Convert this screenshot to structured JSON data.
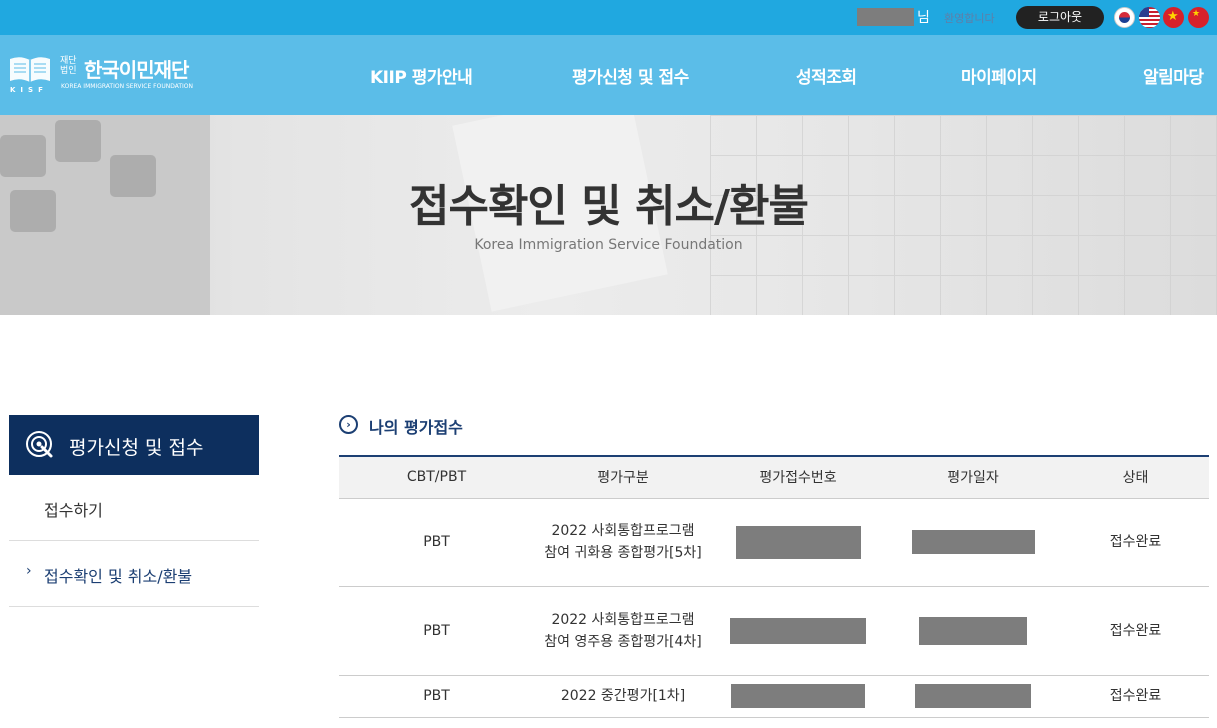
{
  "topbar": {
    "user_suffix": "님",
    "welcome": "환영합니다",
    "logout": "로그아웃",
    "flags": [
      "korea-flag",
      "usa-flag",
      "vietnam-flag",
      "china-flag"
    ]
  },
  "logo": {
    "legal_line1": "재단",
    "legal_line2": "법인",
    "name_ko": "한국이민재단",
    "name_en": "KOREA IMMIGRATION SERVICE FOUNDATION",
    "mark": "KISF"
  },
  "nav": [
    "KIIP 평가안내",
    "평가신청 및 접수",
    "성적조회",
    "마이페이지",
    "알림마당"
  ],
  "hero": {
    "title": "접수확인 및 취소/환불",
    "subtitle": "Korea Immigration Service Foundation"
  },
  "sidebar": {
    "heading": "평가신청 및 접수",
    "items": [
      {
        "label": "접수하기",
        "active": false
      },
      {
        "label": "접수확인 및 취소/환불",
        "active": true
      }
    ]
  },
  "section": {
    "title": "나의 평가접수"
  },
  "table": {
    "headers": [
      "CBT/PBT",
      "평가구분",
      "평가접수번호",
      "평가일자",
      "상태"
    ],
    "rows": [
      {
        "mode": "PBT",
        "type": "2022 사회통합프로그램 참여 귀화용 종합평가[5차]",
        "status": "접수완료"
      },
      {
        "mode": "PBT",
        "type": "2022 사회통합프로그램 참여 영주용 종합평가[4차]",
        "status": "접수완료"
      },
      {
        "mode": "PBT",
        "type": "2022 중간평가[1차]",
        "status": "접수완료"
      }
    ]
  },
  "colors": {
    "topbar": "#20a8e0",
    "nav": "#5bbde8",
    "sidebar_head": "#0d2f5e",
    "accent": "#1c3f73"
  }
}
